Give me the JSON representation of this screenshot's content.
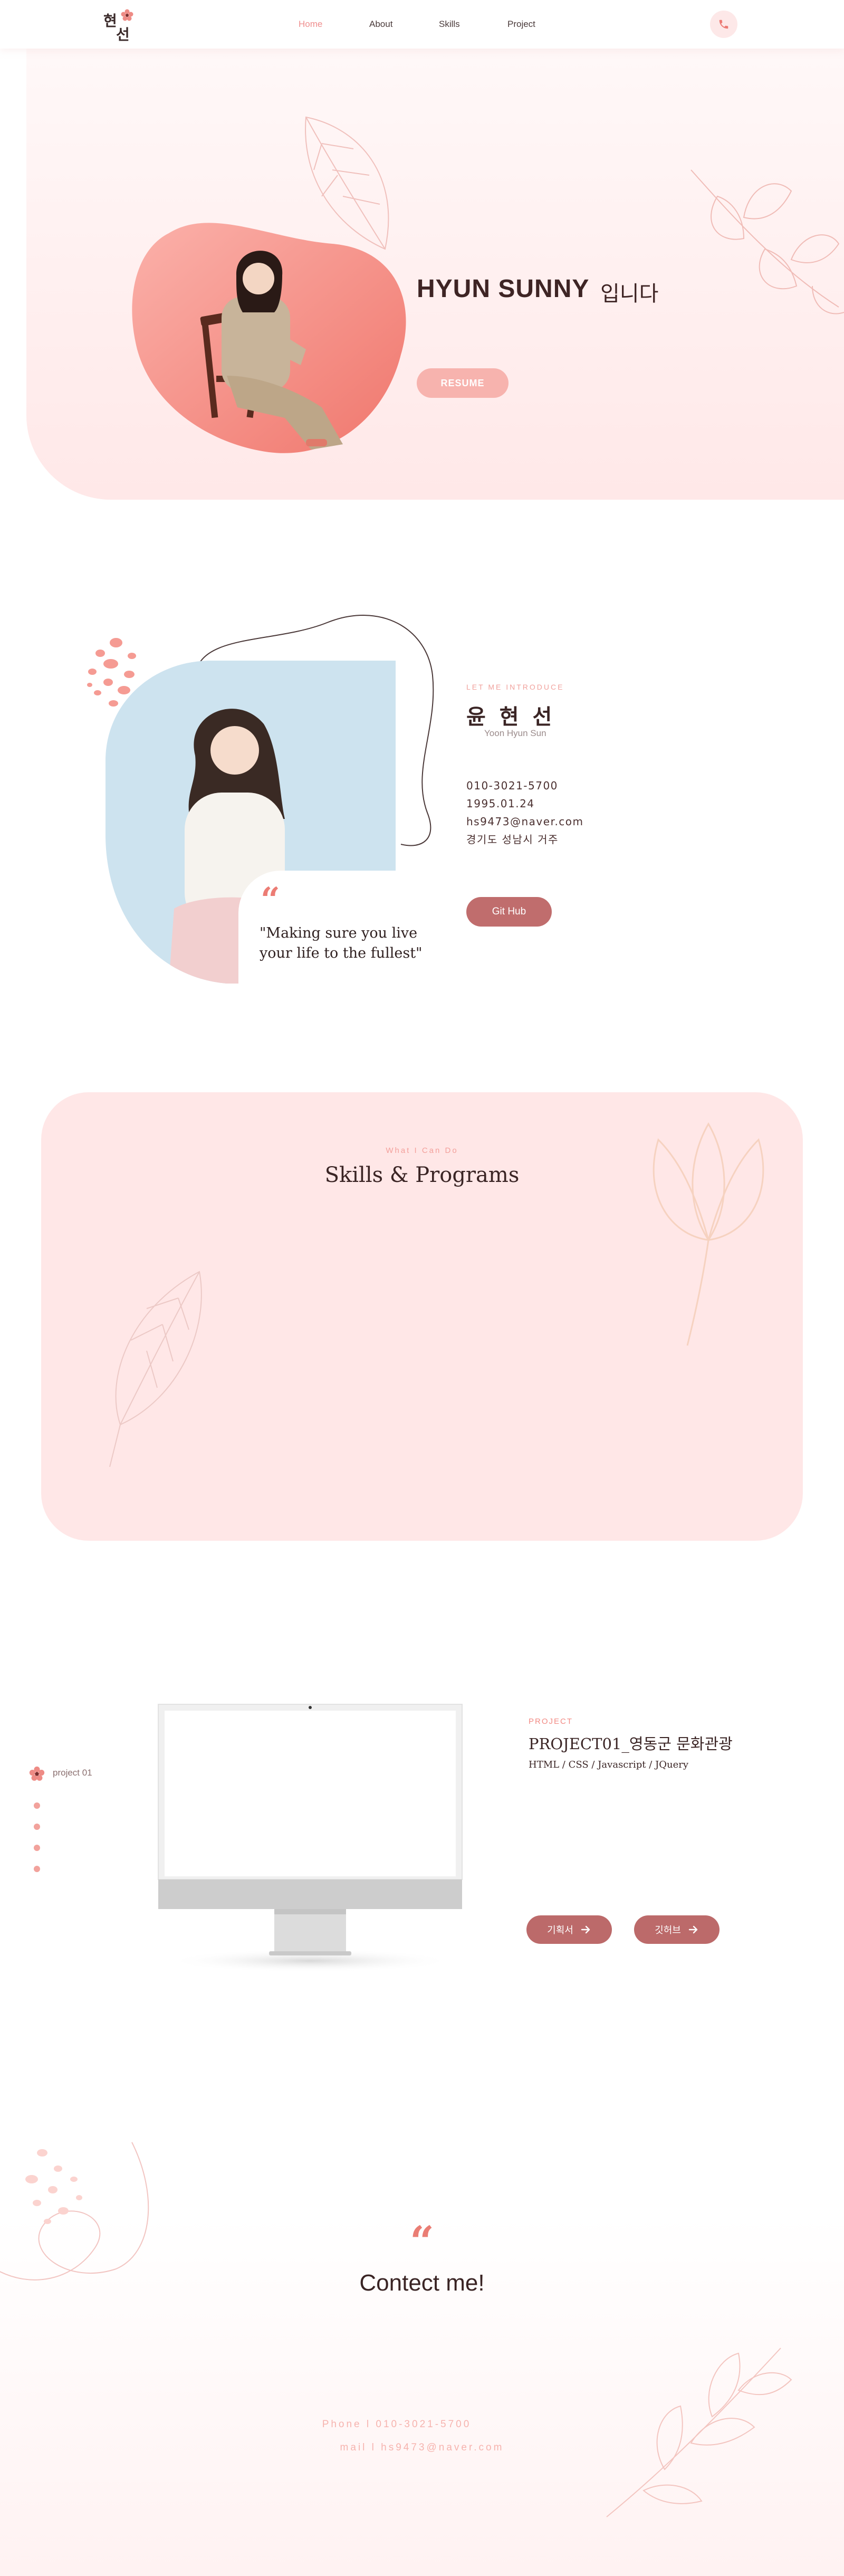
{
  "header": {
    "logo": {
      "char_top": "현",
      "char_bottom": "선"
    },
    "nav": [
      {
        "label": "Home",
        "active": true
      },
      {
        "label": "About",
        "active": false
      },
      {
        "label": "Skills",
        "active": false
      },
      {
        "label": "Project",
        "active": false
      }
    ],
    "phone_icon": "phone-icon"
  },
  "hero": {
    "name": "HYUN SUNNY",
    "suffix": "입니다",
    "resume_label": "RESUME"
  },
  "about": {
    "eyebrow": "LET ME INTRODUCE",
    "name": "윤 현 선",
    "name_roman": "Yoon Hyun Sun",
    "phone": "010-3021-5700",
    "birth": "1995.01.24",
    "email": "hs9473@naver.com",
    "location": "경기도 성남시 거주",
    "github_label": "Git Hub",
    "quote_mark": "“",
    "quote_line1": "\"Making sure you live",
    "quote_line2": "your life to the fullest\""
  },
  "skills": {
    "eyebrow": "What I Can Do",
    "title": "Skills & Programs"
  },
  "project": {
    "side_label": "project 01",
    "eyebrow": "PROJECT",
    "title": "PROJECT01_영동군 문화관광",
    "tech": "HTML / CSS / Javascript / JQuery",
    "btn_plan": "기획서",
    "btn_site": "깃허브"
  },
  "contact": {
    "quote_mark": "“",
    "title": "Contect me!",
    "phone": "Phone l 010-3021-5700",
    "mail": "mail l hs9473@naver.com"
  },
  "colors": {
    "accent": "#ef8e8e",
    "button_dark": "#bc6a6a",
    "button_light": "#f7b3ae",
    "hero_bg": "#ffe8e8",
    "skills_bg": "#ffe7e7"
  }
}
